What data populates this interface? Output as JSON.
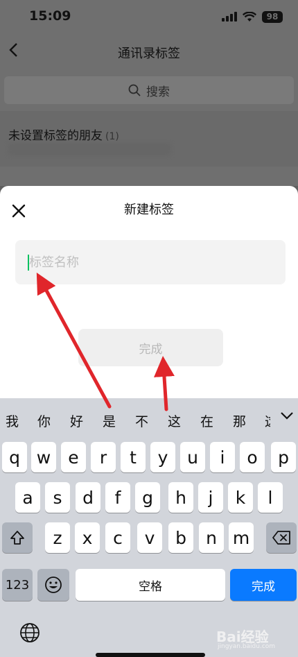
{
  "status_bar": {
    "time": "15:09",
    "battery": "98"
  },
  "background_page": {
    "title": "通讯录标签",
    "search_placeholder": "搜索",
    "row_title": "未设置标签的朋友",
    "row_count": "(1)"
  },
  "sheet": {
    "title": "新建标签",
    "input_placeholder": "标签名称",
    "input_value": "",
    "done_label": "完成"
  },
  "keyboard": {
    "candidates": [
      "我",
      "你",
      "好",
      "是",
      "不",
      "这",
      "在",
      "那",
      "这"
    ],
    "row1": [
      "q",
      "w",
      "e",
      "r",
      "t",
      "y",
      "u",
      "i",
      "o",
      "p"
    ],
    "row2": [
      "a",
      "s",
      "d",
      "f",
      "g",
      "h",
      "j",
      "k",
      "l"
    ],
    "row3": [
      "z",
      "x",
      "c",
      "v",
      "b",
      "n",
      "m"
    ],
    "num_label": "123",
    "space_label": "空格",
    "return_label": "完成"
  },
  "watermark": {
    "text": "Bai经验",
    "sub": "jingyan.baidu.com"
  },
  "colors": {
    "accent_green": "#07c160",
    "keyboard_blue": "#0a7aff",
    "arrow_red": "#e0262b"
  }
}
